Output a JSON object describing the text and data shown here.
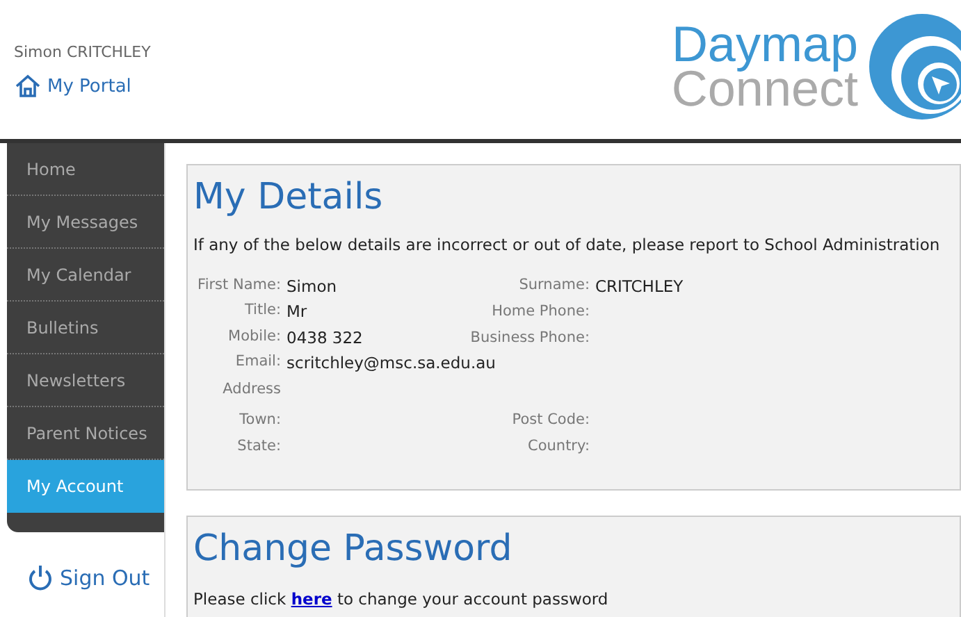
{
  "user": {
    "name": "Simon CRITCHLEY"
  },
  "portal_link": "My Portal",
  "logo": {
    "line_1": "Daymap",
    "line_2": "Connect"
  },
  "sidebar": {
    "items": [
      {
        "label": "Home",
        "selected": false
      },
      {
        "label": "My Messages",
        "selected": false
      },
      {
        "label": "My Calendar",
        "selected": false
      },
      {
        "label": "Bulletins",
        "selected": false
      },
      {
        "label": "Newsletters",
        "selected": false
      },
      {
        "label": "Parent Notices",
        "selected": false
      },
      {
        "label": "My Account",
        "selected": true
      }
    ]
  },
  "sign_out": "Sign Out",
  "details": {
    "title": "My Details",
    "notice": "If any of the below details are incorrect or out of date, please report to School Administration",
    "rows": [
      {
        "left": {
          "label": "First Name:",
          "value": "Simon"
        },
        "right": {
          "label": "Surname:",
          "value": "CRITCHLEY"
        }
      },
      {
        "left": {
          "label": "Title:",
          "value": "Mr"
        },
        "right": {
          "label": "Home Phone:"
        }
      },
      {
        "left": {
          "label": "Mobile:",
          "value": "0438 322"
        },
        "right": {
          "label": "Business Phone:"
        }
      },
      {
        "left": {
          "label": "Email:",
          "value": "scritchley@msc.sa.edu.au"
        }
      },
      {
        "left": {
          "label": "Address"
        }
      },
      {
        "left": {
          "label": "Town:"
        },
        "right": {
          "label": "Post Code:"
        }
      },
      {
        "left": {
          "label": "State:"
        },
        "right": {
          "label": "Country:"
        }
      }
    ]
  },
  "change_password": {
    "title": "Change Password",
    "text_before": "Please click",
    "link": "here",
    "text_after": "to change your account password"
  }
}
